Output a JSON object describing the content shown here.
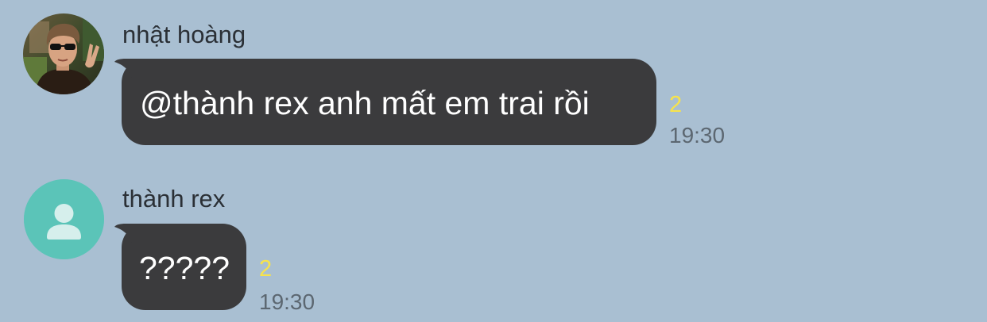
{
  "chat": {
    "messages": [
      {
        "sender": "nhật hoàng",
        "avatar": "photo-avatar",
        "text": "@thành rex anh mất em trai rồi",
        "read_count": "2",
        "time": "19:30"
      },
      {
        "sender": "thành rex",
        "avatar": "default-user-avatar",
        "text": "?????",
        "read_count": "2",
        "time": "19:30"
      }
    ]
  },
  "colors": {
    "background": "#a9bfd2",
    "bubble": "#3b3b3d",
    "unread_count": "#f7e34b",
    "default_avatar": "#5bc4b8"
  }
}
